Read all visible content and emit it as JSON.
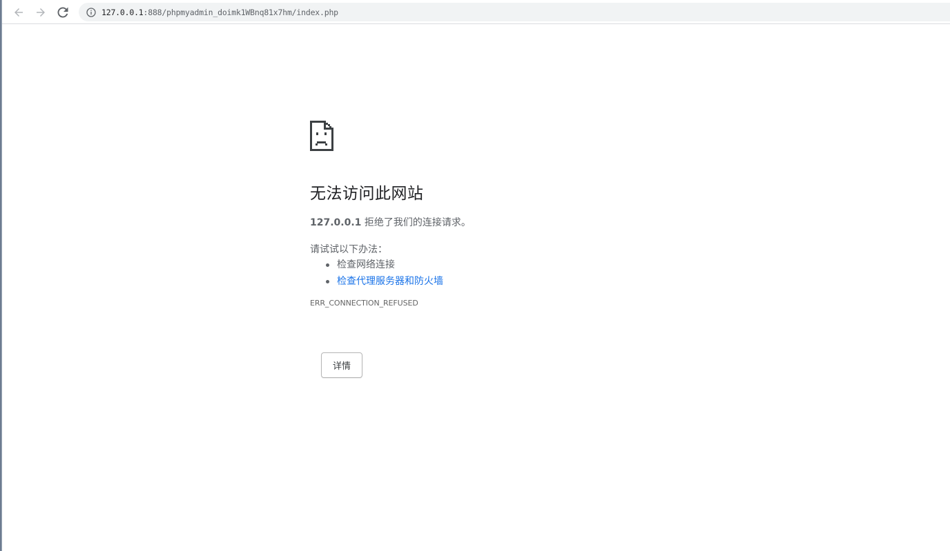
{
  "browser": {
    "url_host": "127.0.0.1",
    "url_path": ":888/phpmyadmin_doimk1WBnq81x7hm/index.php",
    "back_icon": "arrow-left-icon",
    "forward_icon": "arrow-right-icon",
    "reload_icon": "reload-icon",
    "info_icon": "info-icon"
  },
  "error_page": {
    "icon": "sad-page-icon",
    "headline": "无法访问此网站",
    "summary_host": "127.0.0.1",
    "summary_text": " 拒绝了我们的连接请求。",
    "suggestions_title": "请试试以下办法：",
    "suggestions": [
      {
        "text": "检查网络连接"
      },
      {
        "text": "检查代理服务器和防火墙"
      }
    ],
    "error_code": "ERR_CONNECTION_REFUSED",
    "details_button": "详情"
  },
  "colors": {
    "link": "#1a73e8",
    "text_secondary": "#5f6368",
    "omnibox_bg": "#f1f3f4"
  }
}
